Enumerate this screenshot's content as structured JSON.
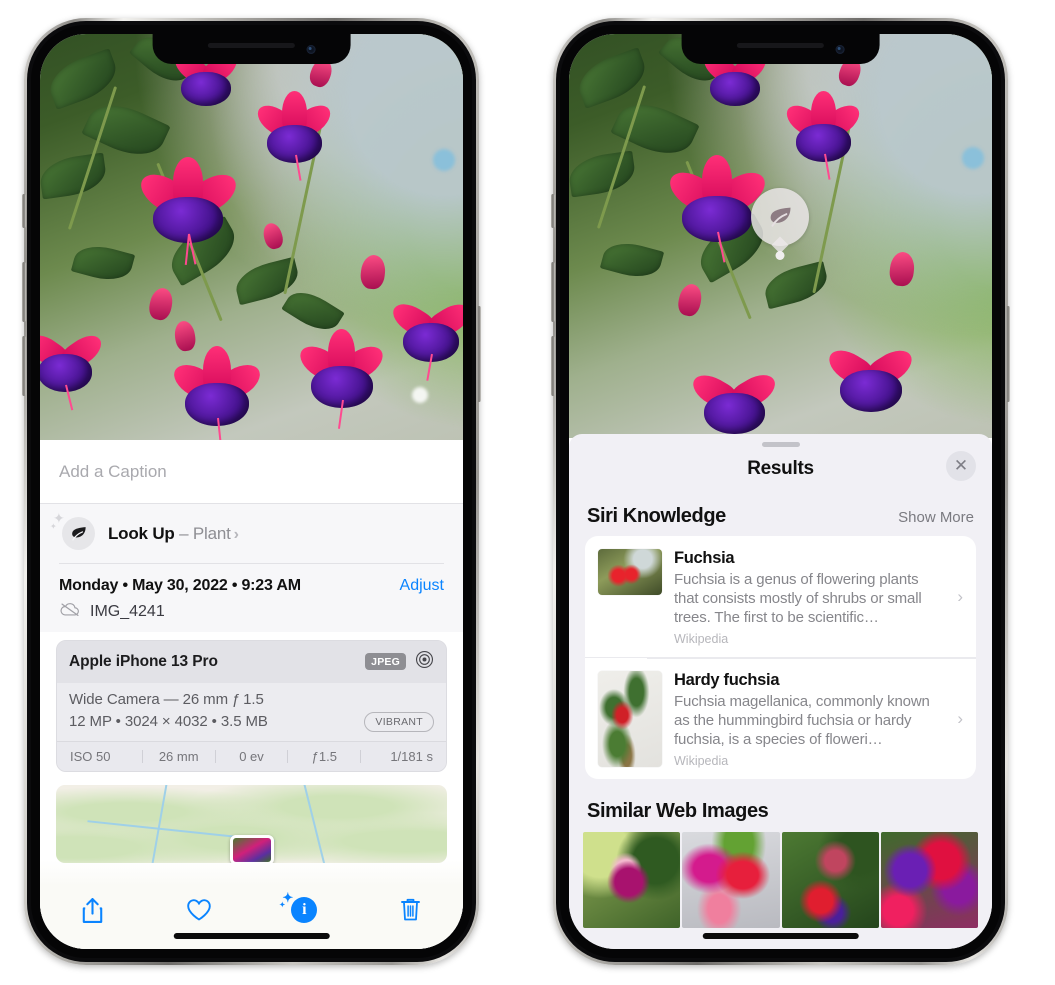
{
  "left_phone": {
    "screen_name": "Photos — Info view",
    "caption": {
      "placeholder": "Add a Caption",
      "value": ""
    },
    "look_up": {
      "icon": "leaf-icon",
      "label": "Look Up",
      "dash": " – ",
      "subject": "Plant",
      "chevron": "›",
      "sparkle": "✦",
      "sparkle_small": "✦"
    },
    "metadata": {
      "date_line": "Monday • May 30, 2022 • 9:23 AM",
      "adjust_label": "Adjust",
      "cloud_icon": "cloud-slash-icon",
      "filename": "IMG_4241"
    },
    "exif": {
      "device": "Apple iPhone 13 Pro",
      "format_tag": "JPEG",
      "lens_icon": "aperture-icon",
      "lens_line": "Wide Camera — 26 mm ƒ 1.5",
      "size_line": "12 MP • 3024 × 4032 • 3.5 MB",
      "style_pill": "VIBRANT",
      "stats": [
        "ISO 50",
        "26 mm",
        "0 ev",
        "ƒ1.5",
        "1/181 s"
      ]
    },
    "map": {
      "name": "location-map-thumbnail"
    },
    "toolbar": [
      {
        "name": "share-button",
        "icon": "share-icon",
        "label": "Share"
      },
      {
        "name": "favorite-button",
        "icon": "heart-icon",
        "label": "Favorite"
      },
      {
        "name": "info-button",
        "icon": "info-sparkle-icon",
        "label": "Info",
        "active": true,
        "glyph": "i"
      },
      {
        "name": "delete-button",
        "icon": "trash-icon",
        "label": "Delete"
      }
    ]
  },
  "right_phone": {
    "screen_name": "Visual Look Up — Results",
    "vlu_badge": {
      "icon": "leaf-icon",
      "label": "Plant indicator"
    },
    "sheet": {
      "grabber": "drag-handle",
      "title": "Results",
      "close_label": "✕"
    },
    "siri_knowledge": {
      "title": "Siri Knowledge",
      "show_more": "Show More",
      "items": [
        {
          "name": "Fuchsia",
          "description": "Fuchsia is a genus of flowering plants that consists mostly of shrubs or small trees. The first to be scientific…",
          "source": "Wikipedia",
          "thumbnail": "fuchsia-red-blooms-thumbnail",
          "chevron": "›"
        },
        {
          "name": "Hardy fuchsia",
          "description": "Fuchsia magellanica, commonly known as the hummingbird fuchsia or hardy fuchsia, is a species of floweri…",
          "source": "Wikipedia",
          "thumbnail": "hardy-fuchsia-branch-thumbnail",
          "chevron": "›"
        }
      ]
    },
    "similar_web_images": {
      "title": "Similar Web Images",
      "items": [
        {
          "name": "similar-image-1"
        },
        {
          "name": "similar-image-2"
        },
        {
          "name": "similar-image-3"
        },
        {
          "name": "similar-image-4"
        }
      ]
    }
  },
  "colors": {
    "accent_blue": "#0a84ff",
    "sheet_bg": "#f1f0f5",
    "card_bg": "#ffffff",
    "exif_bg": "#e9e9ed",
    "secondary_text": "#86868b"
  }
}
